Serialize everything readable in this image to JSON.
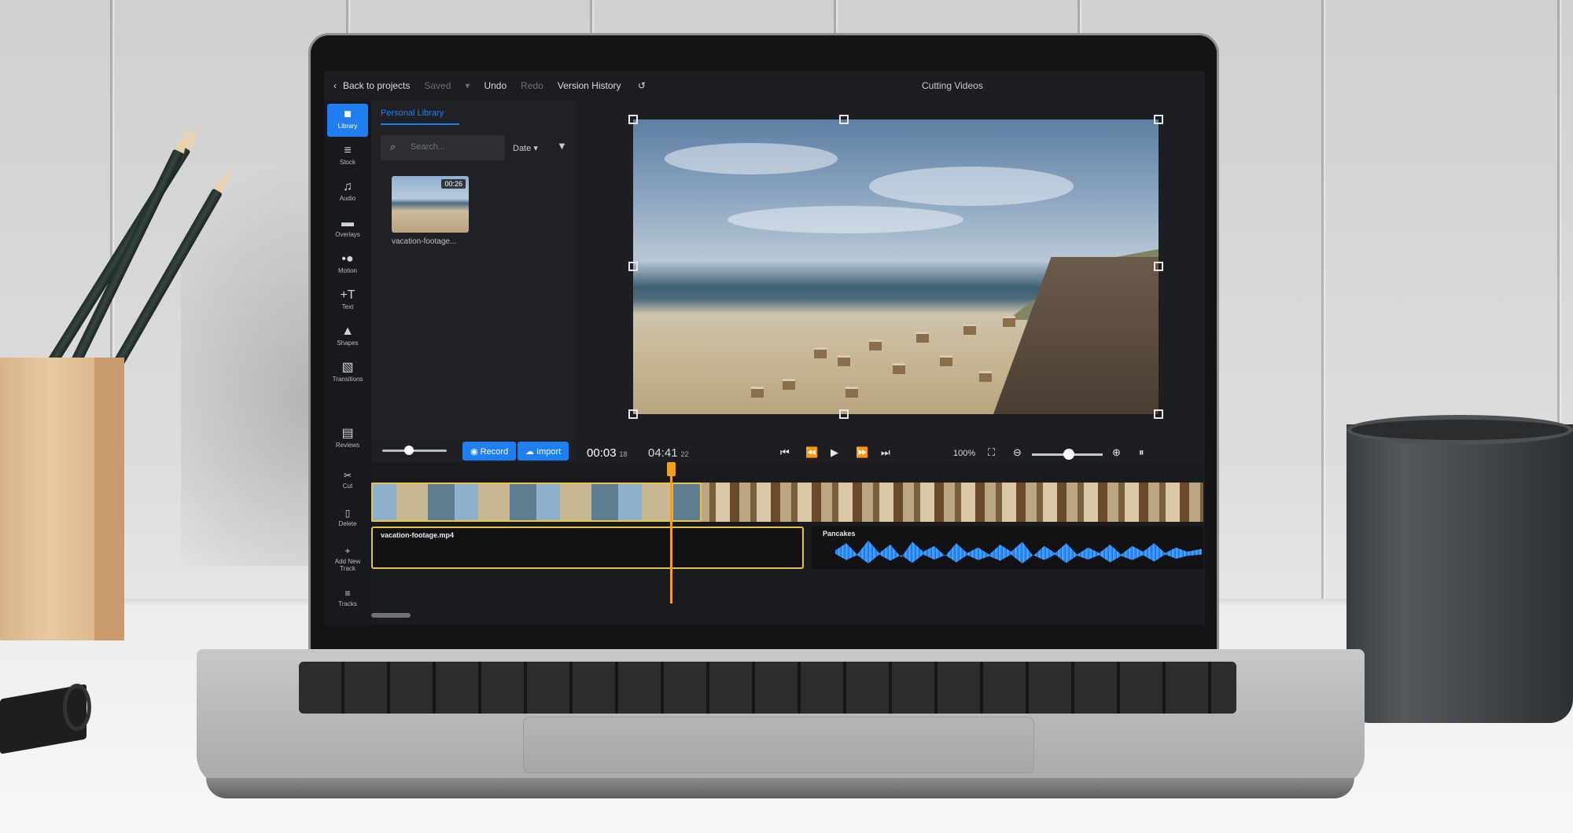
{
  "topbar": {
    "back_label": "Back to projects",
    "saved_label": "Saved",
    "undo_label": "Undo",
    "redo_label": "Redo",
    "version_history_label": "Version History",
    "project_title": "Cutting Videos"
  },
  "sidebar": {
    "items": [
      {
        "label": "Library",
        "icon": "folder-icon"
      },
      {
        "label": "Stock",
        "icon": "stock-icon"
      },
      {
        "label": "Audio",
        "icon": "music-icon"
      },
      {
        "label": "Overlays",
        "icon": "overlay-icon"
      },
      {
        "label": "Motion",
        "icon": "motion-icon"
      },
      {
        "label": "Text",
        "icon": "text-icon"
      },
      {
        "label": "Shapes",
        "icon": "shapes-icon"
      },
      {
        "label": "Transitions",
        "icon": "transitions-icon"
      },
      {
        "label": "Reviews",
        "icon": "reviews-icon"
      }
    ]
  },
  "library": {
    "tab_label": "Personal Library",
    "search_placeholder": "Search...",
    "sort_label": "Date",
    "asset": {
      "duration": "00:26",
      "name": "vacation-footage..."
    }
  },
  "library_controls": {
    "record_label": "Record",
    "import_label": "Import"
  },
  "transport": {
    "current_time": "00:03",
    "current_frames": "18",
    "total_time": "04:41",
    "total_frames": "22",
    "zoom_percent": "100%"
  },
  "timeline": {
    "tools": [
      {
        "label": "Cut",
        "icon": "scissors-icon"
      },
      {
        "label": "Delete",
        "icon": "trash-icon"
      },
      {
        "label": "Add New Track",
        "icon": "add-track-icon"
      },
      {
        "label": "Tracks",
        "icon": "tracks-icon"
      }
    ],
    "video_clip_name": "vacation-footage.mp4",
    "audio_clip_name": "Pancakes"
  },
  "colors": {
    "accent": "#1f7ef0",
    "selection": "#e6c34a",
    "playhead": "#f0a020",
    "waveform": "#2a8cff"
  }
}
